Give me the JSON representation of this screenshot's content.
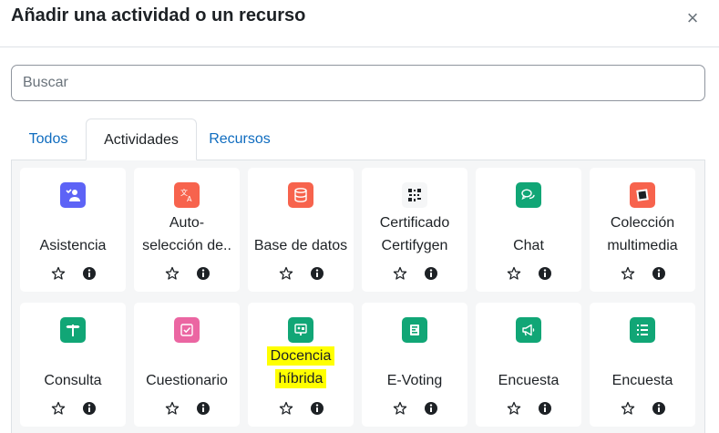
{
  "dialog": {
    "title": "Añadir una actividad o un recurso",
    "close_symbol": "×"
  },
  "search": {
    "placeholder": "Buscar",
    "value": ""
  },
  "tabs": [
    {
      "label": "Todos"
    },
    {
      "label": "Actividades",
      "active": true
    },
    {
      "label": "Recursos"
    }
  ],
  "colors": {
    "accent": "#0f6cbf",
    "purple": "#5d63f6",
    "orange_red": "#f7634d",
    "green": "#11a676",
    "pink": "#eb66a2"
  },
  "modules": [
    {
      "label": "Asistencia",
      "icon": "attendance-icon",
      "color": "#5d63f6"
    },
    {
      "label": "Auto-selección de..",
      "label_lines": [
        "Auto-",
        "selección de.."
      ],
      "icon": "translate-icon",
      "color": "#f7634d"
    },
    {
      "label": "Base de datos",
      "icon": "database-icon",
      "color": "#f7634d"
    },
    {
      "label": "Certificado Certifygen",
      "label_lines": [
        "Certificado",
        "Certifygen"
      ],
      "icon": "qr-code-icon",
      "color": "#f5f6f7"
    },
    {
      "label": "Chat",
      "icon": "chat-icon",
      "color": "#11a676"
    },
    {
      "label": "Colección multimedia",
      "label_lines": [
        "Colección",
        "multimedia"
      ],
      "icon": "media-collection-icon",
      "color": "#f7634d"
    },
    {
      "label": "Consulta",
      "icon": "signpost-icon",
      "color": "#11a676"
    },
    {
      "label": "Cuestionario",
      "icon": "quiz-checkbox-icon",
      "color": "#eb66a2"
    },
    {
      "label": "Docencia híbrida",
      "label_lines": [
        "Docencia",
        "híbrida"
      ],
      "icon": "hybrid-teaching-icon",
      "color": "#11a676",
      "highlighted": true
    },
    {
      "label": "E-Voting",
      "icon": "e-voting-icon",
      "color": "#11a676"
    },
    {
      "label": "Encuesta",
      "icon": "megaphone-icon",
      "color": "#11a676"
    },
    {
      "label": "Encuesta",
      "icon": "list-icon",
      "color": "#11a676"
    }
  ]
}
